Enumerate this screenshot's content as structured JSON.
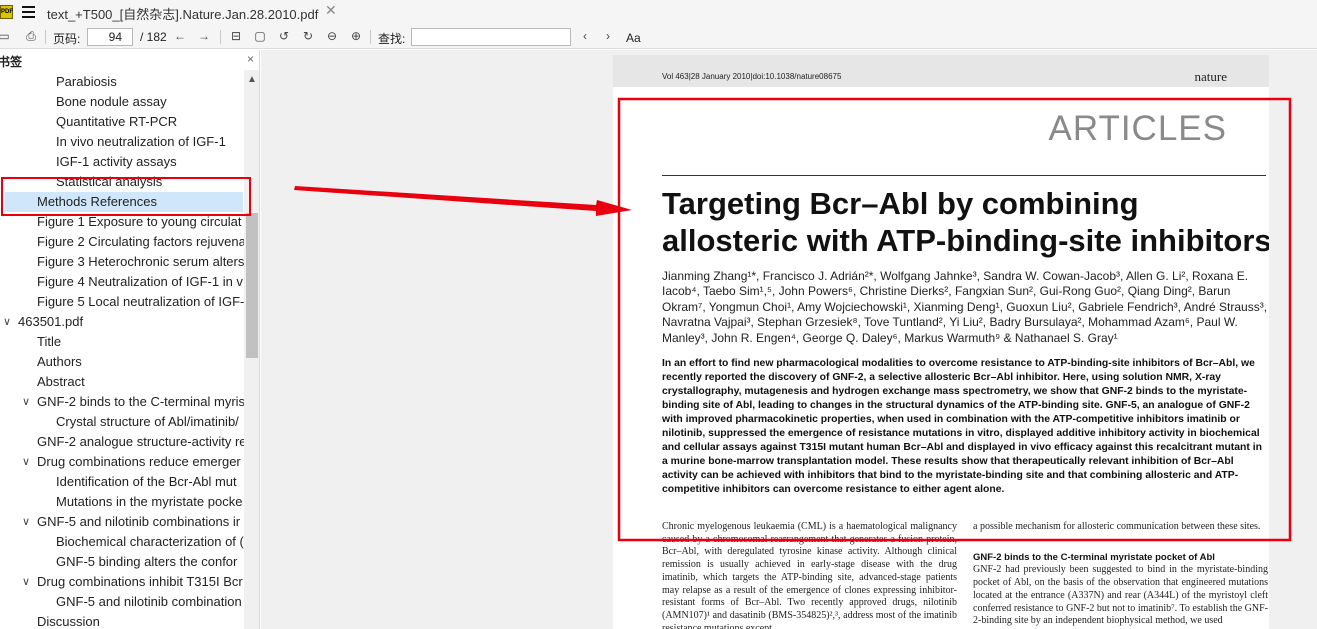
{
  "app": {
    "logo_text": "PDF",
    "tab_title": "text_+T500_[自然杂志].Nature.Jan.28.2010.pdf",
    "tab_close": "✕"
  },
  "toolbar": {
    "page_label": "页码:",
    "current_page": "94",
    "total_pages": "/ 182",
    "find_label": "查找:",
    "find_placeholder": "",
    "icons": [
      "print-icon",
      "printer-icon",
      "prev-page-icon",
      "next-page-icon",
      "fit-page-icon",
      "fit-width-icon",
      "rotate-left-icon",
      "rotate-right-icon",
      "zoom-out-icon",
      "zoom-in-icon",
      "find-prev-icon",
      "find-next-icon",
      "match-case-icon"
    ],
    "match_case_label": "Aa"
  },
  "sidebar": {
    "title": "书签",
    "close": "×",
    "items": [
      {
        "label": "Parabiosis",
        "level": 2,
        "toggle": ""
      },
      {
        "label": "Bone nodule assay",
        "level": 2,
        "toggle": ""
      },
      {
        "label": "Quantitative RT-PCR",
        "level": 2,
        "toggle": ""
      },
      {
        "label": "In vivo neutralization of IGF-1",
        "level": 2,
        "toggle": ""
      },
      {
        "label": "IGF-1 activity assays",
        "level": 2,
        "toggle": ""
      },
      {
        "label": "Statistical analysis",
        "level": 2,
        "toggle": ""
      },
      {
        "label": "Methods References",
        "level": 1,
        "toggle": "",
        "selected": true
      },
      {
        "label": "Figure 1 Exposure to young circulat",
        "level": 1,
        "toggle": ""
      },
      {
        "label": "Figure 2 Circulating factors rejuvena",
        "level": 1,
        "toggle": ""
      },
      {
        "label": "Figure 3 Heterochronic serum alters",
        "level": 1,
        "toggle": ""
      },
      {
        "label": "Figure 4 Neutralization of IGF-1 in v",
        "level": 1,
        "toggle": ""
      },
      {
        "label": "Figure 5 Local neutralization of IGF-",
        "level": 1,
        "toggle": ""
      },
      {
        "label": "463501.pdf",
        "level": 0,
        "toggle": "∨"
      },
      {
        "label": "Title",
        "level": 1,
        "toggle": ""
      },
      {
        "label": "Authors",
        "level": 1,
        "toggle": ""
      },
      {
        "label": "Abstract",
        "level": 1,
        "toggle": ""
      },
      {
        "label": "GNF-2 binds to the C-terminal myris",
        "level": 1,
        "toggle": "∨"
      },
      {
        "label": "Crystal structure of Abl/imatinib/",
        "level": 2,
        "toggle": ""
      },
      {
        "label": "GNF-2 analogue structure-activity re",
        "level": 1,
        "toggle": ""
      },
      {
        "label": "Drug combinations reduce emerger",
        "level": 1,
        "toggle": "∨"
      },
      {
        "label": "Identification of the Bcr-Abl mut",
        "level": 2,
        "toggle": ""
      },
      {
        "label": "Mutations in the myristate pocke",
        "level": 2,
        "toggle": ""
      },
      {
        "label": "GNF-5 and nilotinib combinations ir",
        "level": 1,
        "toggle": "∨"
      },
      {
        "label": "Biochemical characterization of (",
        "level": 2,
        "toggle": ""
      },
      {
        "label": "GNF-5 binding alters the confor",
        "level": 2,
        "toggle": ""
      },
      {
        "label": "Drug combinations inhibit T315I Bcr",
        "level": 1,
        "toggle": "∨"
      },
      {
        "label": "GNF-5 and nilotinib combination",
        "level": 2,
        "toggle": ""
      },
      {
        "label": "Discussion",
        "level": 1,
        "toggle": ""
      }
    ]
  },
  "document": {
    "header_left": "Vol 463|28 January 2010|doi:10.1038/nature08675",
    "header_right": "nature",
    "section_label": "ARTICLES",
    "title": "Targeting Bcr–Abl by combining allosteric with ATP-binding-site inhibitors",
    "authors": "Jianming Zhang¹*, Francisco J. Adrián²*, Wolfgang Jahnke³, Sandra W. Cowan-Jacob³, Allen G. Li², Roxana E. Iacob⁴, Taebo Sim¹,⁵, John Powers⁶, Christine Dierks², Fangxian Sun², Gui-Rong Guo², Qiang Ding², Barun Okram⁷, Yongmun Choi¹, Amy Wojciechowski¹, Xianming Deng¹, Guoxun Liu², Gabriele Fendrich³, André Strauss³, Navratna Vajpai³, Stephan Grzesiek⁸, Tove Tuntland², Yi Liu², Badry Bursulaya², Mohammad Azam⁶, Paul W. Manley³, John R. Engen⁴, George Q. Daley⁶, Markus Warmuth⁹ & Nathanael S. Gray¹",
    "abstract": "In an effort to find new pharmacological modalities to overcome resistance to ATP-binding-site inhibitors of Bcr–Abl, we recently reported the discovery of GNF-2, a selective allosteric Bcr–Abl inhibitor. Here, using solution NMR, X-ray crystallography, mutagenesis and hydrogen exchange mass spectrometry, we show that GNF-2 binds to the myristate-binding site of Abl, leading to changes in the structural dynamics of the ATP-binding site. GNF-5, an analogue of GNF-2 with improved pharmacokinetic properties, when used in combination with the ATP-competitive inhibitors imatinib or nilotinib, suppressed the emergence of resistance mutations in vitro, displayed additive inhibitory activity in biochemical and cellular assays against T315I mutant human Bcr–Abl and displayed in vivo efficacy against this recalcitrant mutant in a murine bone-marrow transplantation model. These results show that therapeutically relevant inhibition of Bcr–Abl activity can be achieved with inhibitors that bind to the myristate-binding site and that combining allosteric and ATP-competitive inhibitors can overcome resistance to either agent alone.",
    "col1": "Chronic myelogenous leukaemia (CML) is a haematological malignancy caused by a chromosomal rearrangement that generates a fusion protein, Bcr–Abl, with deregulated tyrosine kinase activity. Although clinical remission is usually achieved in early-stage disease with the drug imatinib, which targets the ATP-binding site, advanced-stage patients may relapse as a result of the emergence of clones expressing inhibitor-resistant forms of Bcr–Abl. Two recently approved drugs, nilotinib (AMN107)¹ and dasatinib (BMS-354825)²,³, address most of the imatinib resistance mutations except",
    "col2_top": "a possible mechanism for allosteric communication between these sites.",
    "col2_heading": "GNF-2 binds to the C-terminal myristate pocket of Abl",
    "col2_body": "GNF-2 had previously been suggested to bind in the myristate-binding pocket of Abl, on the basis of the observation that engineered mutations located at the entrance (A337N) and rear (A344L) of the myristoyl cleft conferred resistance to GNF-2 but not to imatinib⁷. To establish the GNF-2-binding site by an independent biophysical method, we used"
  },
  "colors": {
    "annotation": "#e8000f",
    "selection": "#cfe6fb",
    "toolbar_bg": "#f5f5f5",
    "viewer_bg": "#f0f0f0"
  }
}
